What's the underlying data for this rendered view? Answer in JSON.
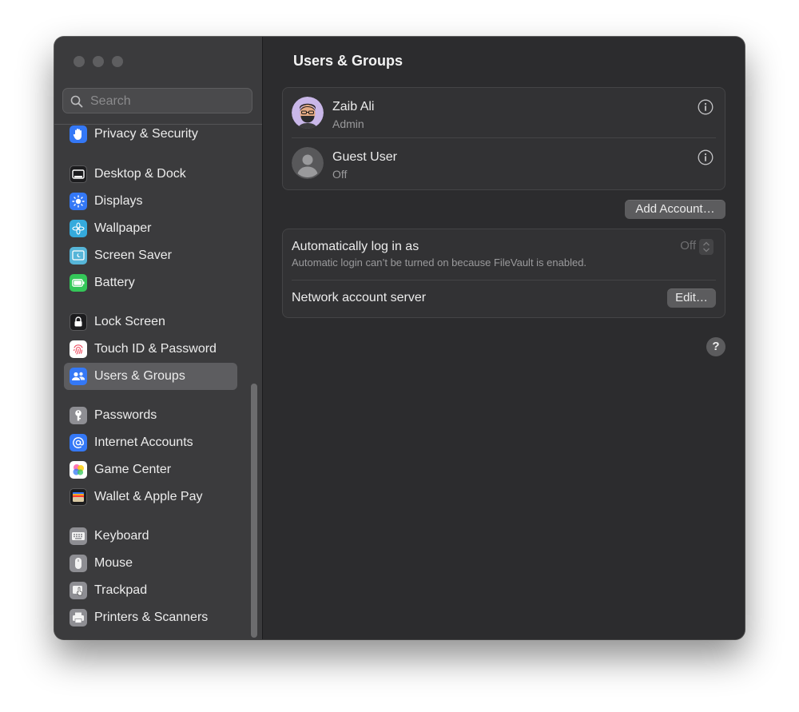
{
  "sidebar": {
    "search_placeholder": "Search",
    "items": [
      {
        "label": "Privacy & Security",
        "icon": "hand-icon",
        "color": "#3478f6"
      },
      {
        "label": "Desktop & Dock",
        "icon": "dock-icon",
        "color": "#1c1c1e"
      },
      {
        "label": "Displays",
        "icon": "sun-icon",
        "color": "#3478f6"
      },
      {
        "label": "Wallpaper",
        "icon": "flower-icon",
        "color": "#35aadc"
      },
      {
        "label": "Screen Saver",
        "icon": "screen-saver-icon",
        "color": "#56b5d8"
      },
      {
        "label": "Battery",
        "icon": "battery-icon",
        "color": "#34c759"
      },
      {
        "label": "Lock Screen",
        "icon": "lock-icon",
        "color": "#1c1c1e"
      },
      {
        "label": "Touch ID & Password",
        "icon": "fingerprint-icon",
        "color": "#ffffff"
      },
      {
        "label": "Users & Groups",
        "icon": "users-icon",
        "color": "#3478f6",
        "selected": true
      },
      {
        "label": "Passwords",
        "icon": "key-icon",
        "color": "#8e8e93"
      },
      {
        "label": "Internet Accounts",
        "icon": "at-icon",
        "color": "#3478f6"
      },
      {
        "label": "Game Center",
        "icon": "game-center-icon",
        "color": "#ffffff"
      },
      {
        "label": "Wallet & Apple Pay",
        "icon": "wallet-icon",
        "color": "#1c1c1e"
      },
      {
        "label": "Keyboard",
        "icon": "keyboard-icon",
        "color": "#8e8e93"
      },
      {
        "label": "Mouse",
        "icon": "mouse-icon",
        "color": "#8e8e93"
      },
      {
        "label": "Trackpad",
        "icon": "trackpad-icon",
        "color": "#8e8e93"
      },
      {
        "label": "Printers & Scanners",
        "icon": "printer-icon",
        "color": "#8e8e93"
      }
    ]
  },
  "main": {
    "title": "Users & Groups",
    "users": [
      {
        "name": "Zaib Ali",
        "role": "Admin",
        "avatar": "memoji-avatar"
      },
      {
        "name": "Guest User",
        "role": "Off",
        "avatar": "generic-user-avatar"
      }
    ],
    "add_account_label": "Add Account…",
    "auto_login": {
      "title": "Automatically log in as",
      "subtitle": "Automatic login can’t be turned on because FileVault is enabled.",
      "value": "Off"
    },
    "network_server": {
      "title": "Network account server",
      "button_label": "Edit…"
    },
    "help_label": "?"
  },
  "colors": {
    "accent": "#3478f6",
    "window_bg": "#2c2c2e",
    "sidebar_bg": "#3b3b3d",
    "selected_bg": "#5d5d60"
  }
}
